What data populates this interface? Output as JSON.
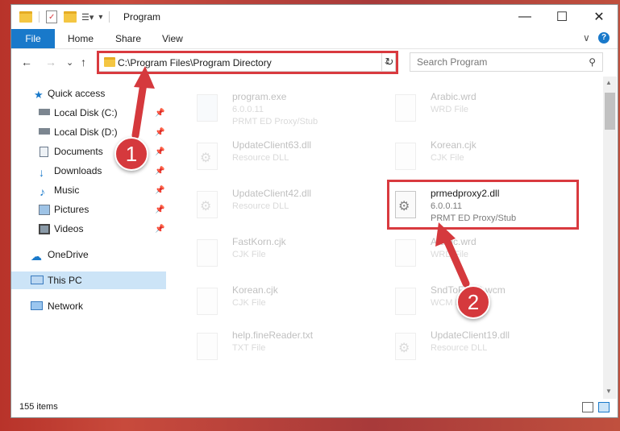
{
  "window": {
    "title": "Program",
    "controls": {
      "minimize": "—",
      "maximize": "☐",
      "close": "✕"
    }
  },
  "ribbon": {
    "file_tab": "File",
    "tabs": [
      "Home",
      "Share",
      "View"
    ],
    "expand_icon": "∨",
    "help_icon": "?"
  },
  "address_bar": {
    "path": "C:\\Program Files\\Program Directory",
    "dropdown": "⌄",
    "refresh": "↻"
  },
  "search": {
    "placeholder": "Search Program",
    "icon": "⚲"
  },
  "nav": {
    "back": "←",
    "forward": "→",
    "recent": "⌄",
    "up": "↑"
  },
  "sidebar": {
    "quick_access": "Quick access",
    "items": [
      {
        "label": "Local Disk (C:)",
        "icon": "drive-icon",
        "pinned": true
      },
      {
        "label": "Local Disk (D:)",
        "icon": "drive-icon",
        "pinned": true
      },
      {
        "label": "Documents",
        "icon": "documents-icon",
        "pinned": true
      },
      {
        "label": "Downloads",
        "icon": "downloads-icon",
        "pinned": true
      },
      {
        "label": "Music",
        "icon": "music-icon",
        "pinned": true
      },
      {
        "label": "Pictures",
        "icon": "pictures-icon",
        "pinned": true
      },
      {
        "label": "Videos",
        "icon": "videos-icon",
        "pinned": true
      }
    ],
    "onedrive": "OneDrive",
    "this_pc": "This PC",
    "network": "Network",
    "pin_glyph": "📌"
  },
  "files": [
    {
      "name": "program.exe",
      "line2": "6.0.0.11",
      "line3": "PRMT ED Proxy/Stub",
      "icon": "exe-icon",
      "faded": true
    },
    {
      "name": "Arabic.wrd",
      "line2": "WRD File",
      "line3": "",
      "icon": "file-icon",
      "faded": true
    },
    {
      "name": "UpdateClient63.dll",
      "line2": "Resource DLL",
      "line3": "",
      "icon": "dll-icon",
      "faded": true
    },
    {
      "name": "Korean.cjk",
      "line2": "CJK File",
      "line3": "",
      "icon": "file-icon",
      "faded": true
    },
    {
      "name": "UpdateClient42.dll",
      "line2": "Resource DLL",
      "line3": "",
      "icon": "dll-icon",
      "faded": true
    },
    {
      "name": "prmedproxy2.dll",
      "line2": "6.0.0.11",
      "line3": "PRMT ED Proxy/Stub",
      "icon": "dll-icon",
      "faded": false
    },
    {
      "name": "FastKorn.cjk",
      "line2": "CJK File",
      "line3": "",
      "icon": "file-icon",
      "faded": true
    },
    {
      "name": "Arabic.wrd",
      "line2": "WRD File",
      "line3": "",
      "icon": "file-icon",
      "faded": true
    },
    {
      "name": "Korean.cjk",
      "line2": "CJK File",
      "line3": "",
      "icon": "file-icon",
      "faded": true
    },
    {
      "name": "SndToFRB9.wcm",
      "line2": "WCM File",
      "line3": "",
      "icon": "file-icon",
      "faded": true
    },
    {
      "name": "help.fineReader.txt",
      "line2": "TXT File",
      "line3": "",
      "icon": "file-icon",
      "faded": true
    },
    {
      "name": "UpdateClient19.dll",
      "line2": "Resource DLL",
      "line3": "",
      "icon": "dll-icon",
      "faded": true
    }
  ],
  "status_bar": {
    "items_count": "155 items"
  },
  "annotations": [
    {
      "number": "1"
    },
    {
      "number": "2"
    }
  ],
  "colors": {
    "accent": "#1979ca",
    "highlight": "#d93a3f",
    "selected": "#cce4f7"
  }
}
